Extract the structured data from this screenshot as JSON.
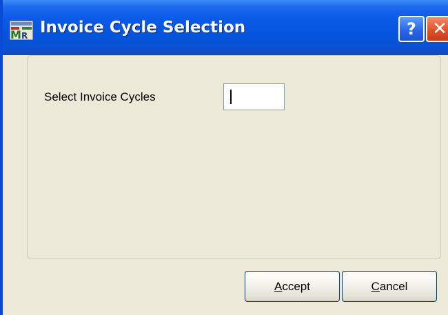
{
  "window": {
    "title": "Invoice Cycle Selection",
    "app_icon": "mas-90-app-icon",
    "help_button": "?",
    "close_button": "✕"
  },
  "form": {
    "label": "Select Invoice Cycles",
    "input_value": ""
  },
  "buttons": {
    "accept": {
      "mnemonic": "A",
      "rest": "ccept"
    },
    "cancel": {
      "mnemonic": "C",
      "rest": "ancel"
    }
  },
  "colors": {
    "title_bar": "#0a5ae6",
    "dialog_face": "#ece9d8",
    "close_red": "#e0522b"
  }
}
